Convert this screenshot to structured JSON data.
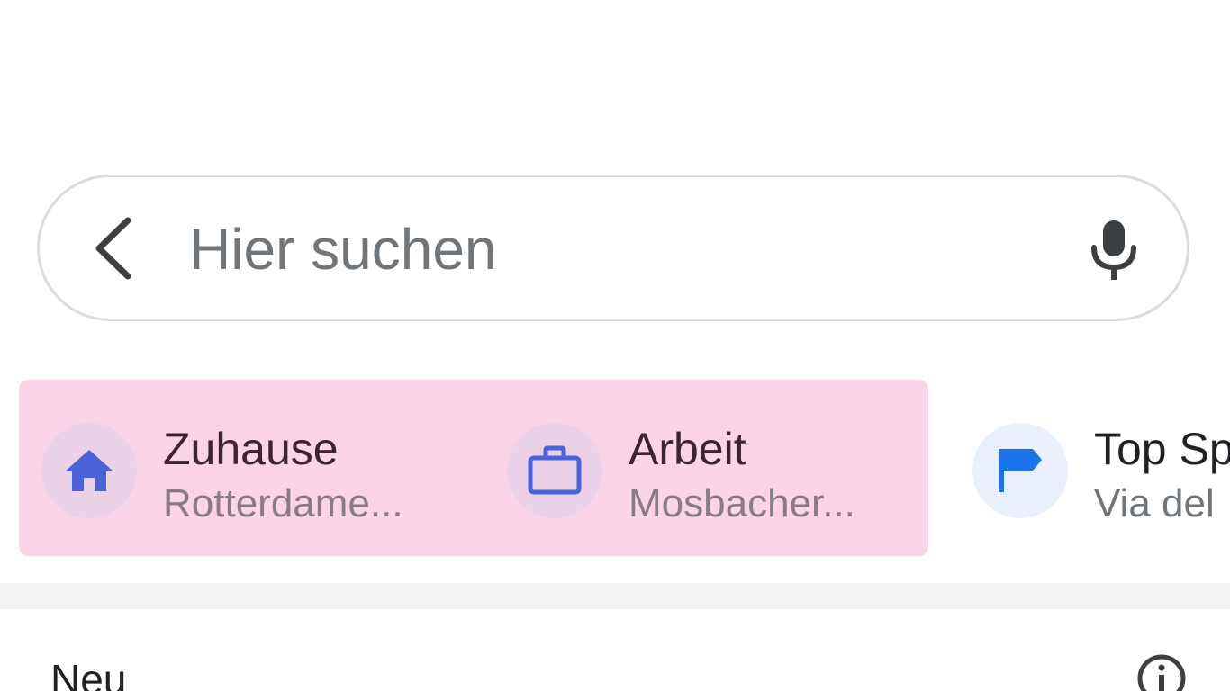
{
  "search": {
    "placeholder": "Hier suchen",
    "value": ""
  },
  "shortcuts": [
    {
      "label": "Zuhause",
      "sublabel": "Rotterdame...",
      "icon": "home-icon",
      "color": "#4a63d8"
    },
    {
      "label": "Arbeit",
      "sublabel": "Mosbacher...",
      "icon": "briefcase-icon",
      "color": "#4a63d8"
    },
    {
      "label": "Top Sp",
      "sublabel": "Via del",
      "icon": "flag-icon",
      "color": "#1a73e8"
    }
  ],
  "section": {
    "title": "Neu"
  },
  "colors": {
    "highlight": "#fbd5e7",
    "search_border": "#dadce0",
    "divider": "#f1f3f4"
  }
}
